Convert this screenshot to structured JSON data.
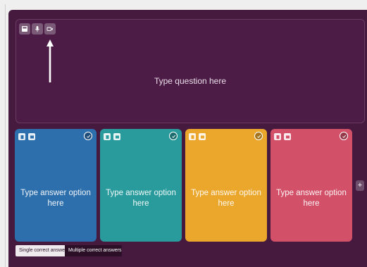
{
  "question": {
    "placeholder": "Type question here",
    "media_buttons": [
      {
        "icon": "image-icon"
      },
      {
        "icon": "microphone-icon"
      },
      {
        "icon": "video-icon"
      }
    ]
  },
  "answers": [
    {
      "placeholder": "Type answer option here",
      "color": "#2d6eac"
    },
    {
      "placeholder": "Type answer option here",
      "color": "#2a9b9c"
    },
    {
      "placeholder": "Type answer option here",
      "color": "#eba72c"
    },
    {
      "placeholder": "Type answer option here",
      "color": "#d35168"
    }
  ],
  "add_option": {
    "label": "+"
  },
  "answer_mode": {
    "single_label": "Single correct answer",
    "multiple_label": "Multiple correct answers",
    "selected": "single"
  },
  "colors": {
    "background": "#46193f",
    "question_box": "#4c1c47"
  }
}
